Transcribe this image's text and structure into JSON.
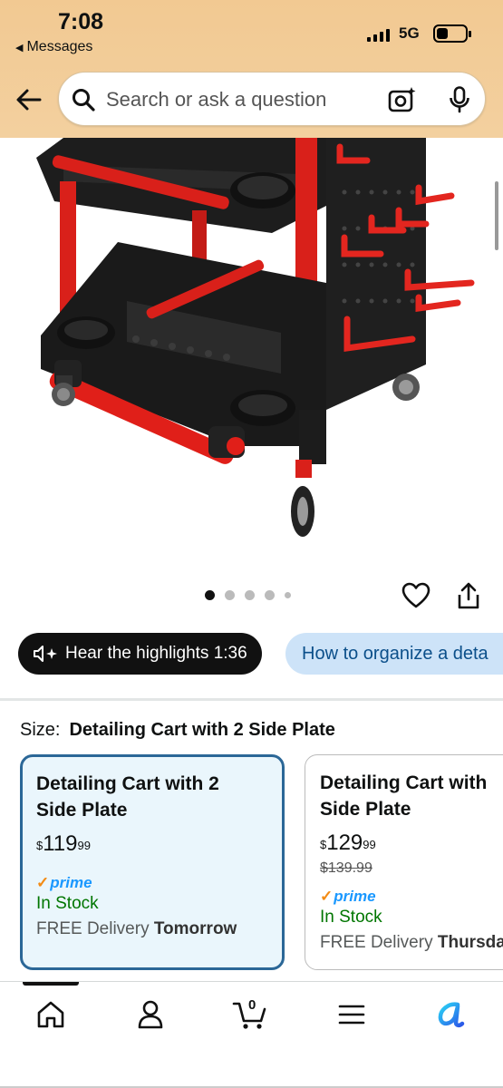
{
  "status_bar": {
    "time": "7:08",
    "back_app": "Messages",
    "network": "5G"
  },
  "search": {
    "placeholder": "Search or ask a question"
  },
  "carousel": {
    "total": 5,
    "active_index": 0
  },
  "chips": {
    "highlights": "Hear the highlights 1:36",
    "question": "How to organize a deta"
  },
  "size": {
    "label": "Size:",
    "selected": "Detailing Cart with 2 Side Plate"
  },
  "options": [
    {
      "title_line1": "Detailing Cart with 2",
      "title_line2": "Side Plate",
      "price_currency": "$",
      "price_whole": "119",
      "price_cents": "99",
      "list_price": "",
      "prime": "prime",
      "stock": "In Stock",
      "delivery_prefix": "FREE Delivery",
      "delivery_day": "Tomorrow"
    },
    {
      "title_line1": "Detailing Cart with",
      "title_line2": "Side Plate",
      "price_currency": "$",
      "price_whole": "129",
      "price_cents": "99",
      "list_price": "$139.99",
      "prime": "prime",
      "stock": "In Stock",
      "delivery_prefix": "FREE Delivery",
      "delivery_day": "Thursda"
    }
  ],
  "bottom_nav": {
    "cart_count": "0"
  },
  "colors": {
    "header": "#f2c992",
    "prime_blue": "#1a98ff",
    "prime_check": "#f38b14",
    "stock_green": "#007600",
    "selected_border": "#2b6797"
  }
}
